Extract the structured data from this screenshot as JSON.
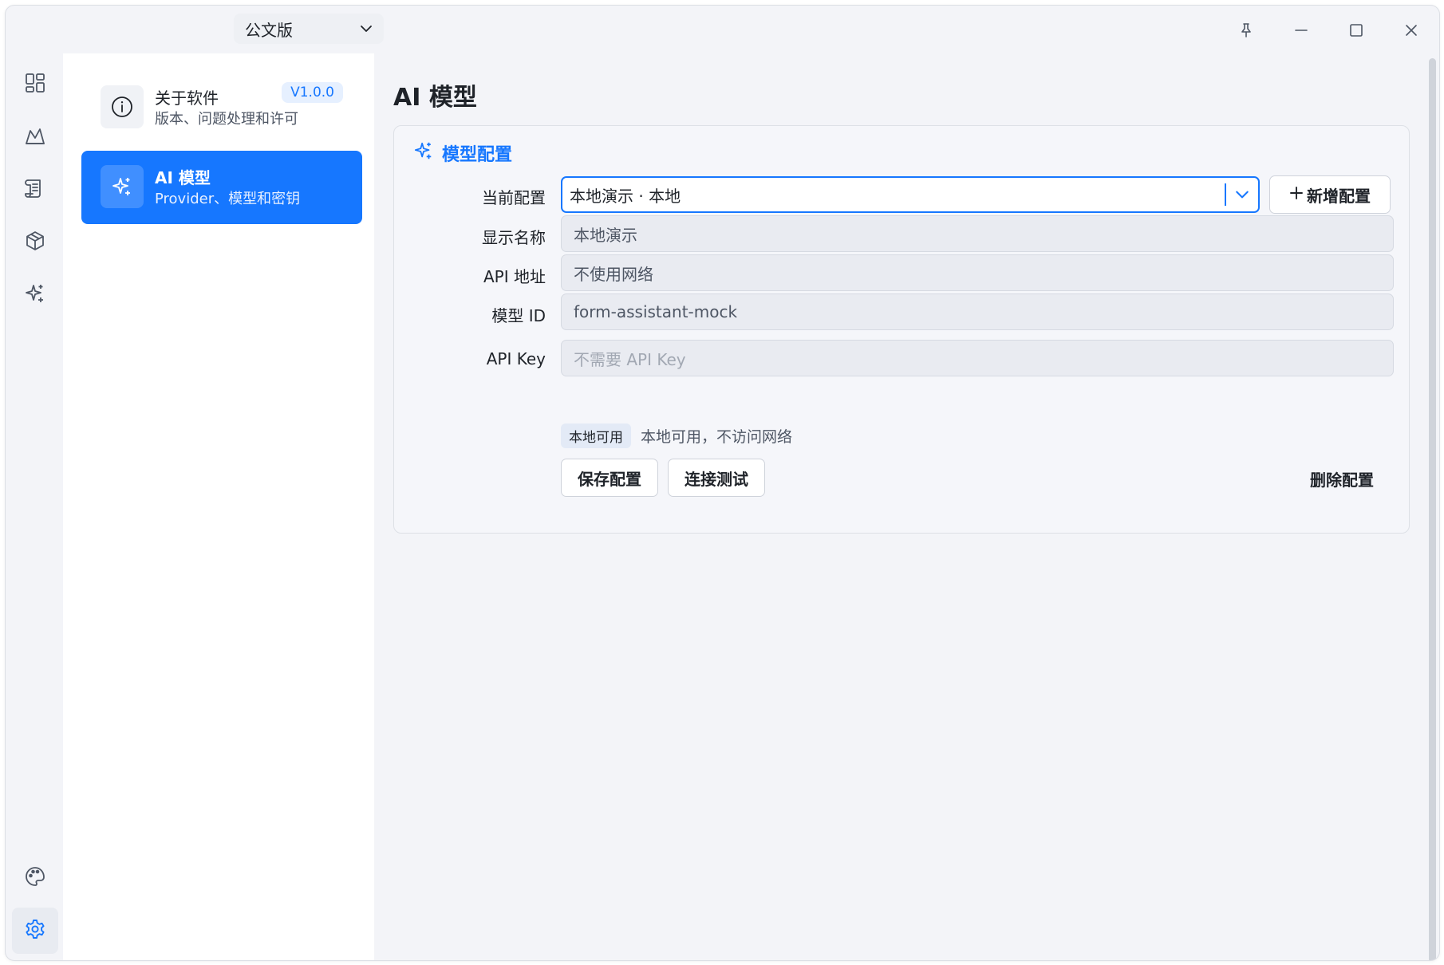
{
  "titlebar": {
    "edition": "公文版",
    "pin_icon": "pin-icon",
    "minimize_icon": "minimize-icon",
    "maximize_icon": "maximize-icon",
    "close_icon": "close-icon"
  },
  "rail": {
    "items": [
      "dashboard-icon",
      "chart-icon",
      "document-icon",
      "package-icon",
      "sparkle-icon"
    ],
    "bottom": [
      "palette-icon",
      "settings-icon"
    ],
    "active": "settings-icon"
  },
  "settings_nav": {
    "items": [
      {
        "title": "关于软件",
        "subtitle": "版本、问题处理和许可",
        "badge": "V1.0.0",
        "icon": "info-icon"
      },
      {
        "title": "AI 模型",
        "subtitle": "Provider、模型和密钥",
        "icon": "sparkle-icon",
        "active": true
      }
    ]
  },
  "main": {
    "title": "AI 模型",
    "card": {
      "title": "模型配置",
      "current_config_label": "当前配置",
      "current_config_value": "本地演示 · 本地",
      "add_button": "新增配置",
      "display_name_label": "显示名称",
      "display_name_value": "本地演示",
      "api_url_label": "API 地址",
      "api_url_value": "不使用网络",
      "model_id_label": "模型 ID",
      "model_id_value": "form-assistant-mock",
      "api_key_label": "API Key",
      "api_key_placeholder": "不需要 API Key",
      "status_tag": "本地可用",
      "status_text": "本地可用，不访问网络",
      "save_button": "保存配置",
      "test_button": "连接测试",
      "delete_button": "删除配置"
    }
  },
  "colors": {
    "accent": "#1677ff",
    "background": "#f3f4f8",
    "sidebar": "#ffffff"
  }
}
